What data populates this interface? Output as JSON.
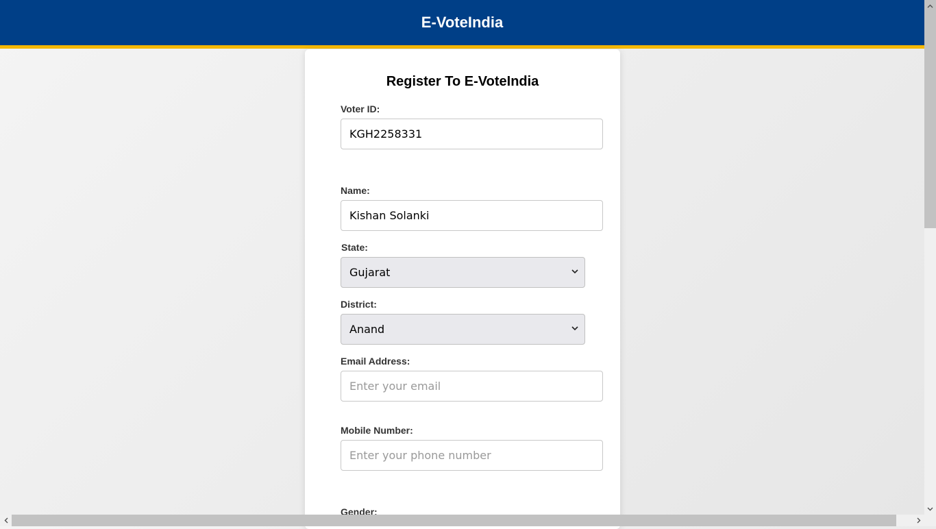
{
  "header": {
    "title": "E-VoteIndia"
  },
  "form": {
    "title": "Register To E-VoteIndia",
    "voter_id": {
      "label": "Voter ID:",
      "value": "KGH2258331"
    },
    "name": {
      "label": "Name:",
      "value": "Kishan Solanki"
    },
    "state": {
      "label": "State:",
      "value": "Gujarat"
    },
    "district": {
      "label": "District:",
      "value": "Anand"
    },
    "email": {
      "label": "Email Address:",
      "placeholder": "Enter your email"
    },
    "mobile": {
      "label": "Mobile Number:",
      "placeholder": "Enter your phone number"
    },
    "gender": {
      "label": "Gender:"
    }
  },
  "colors": {
    "header_bg": "#003f87",
    "header_accent": "#f5b800"
  },
  "icons": {
    "select_arrow": "chevron-down-icon"
  }
}
